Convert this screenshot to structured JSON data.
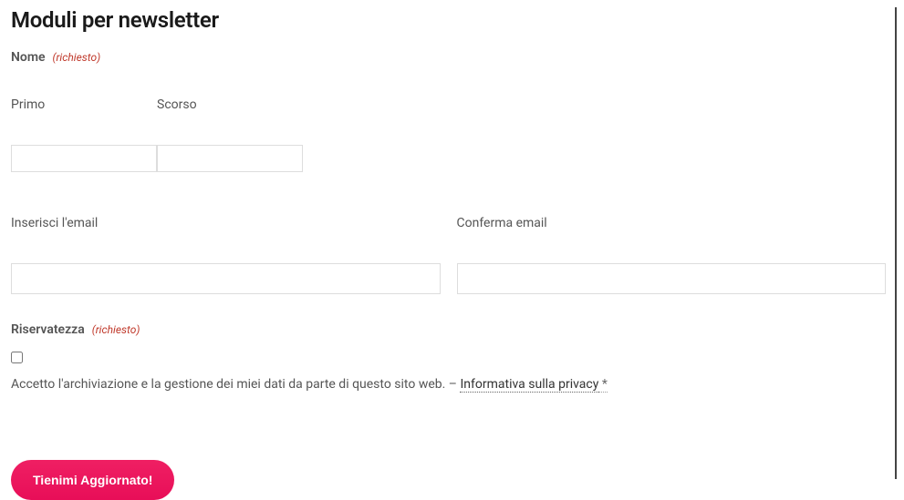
{
  "title": "Moduli per newsletter",
  "name_section": {
    "label": "Nome",
    "required_text": "(richiesto)",
    "first_label": "Primo",
    "last_label": "Scorso",
    "first_value": "",
    "last_value": ""
  },
  "email_section": {
    "enter_label": "Inserisci l'email",
    "confirm_label": "Conferma email",
    "enter_value": "",
    "confirm_value": ""
  },
  "privacy_section": {
    "label": "Riservatezza",
    "required_text": "(richiesto)",
    "consent_text": "Accetto l'archiviazione e la gestione dei miei dati da parte di questo sito web. – ",
    "link_text": "Informativa sulla privacy",
    "asterisk": " *"
  },
  "submit_label": "Tienimi Aggiornato!"
}
